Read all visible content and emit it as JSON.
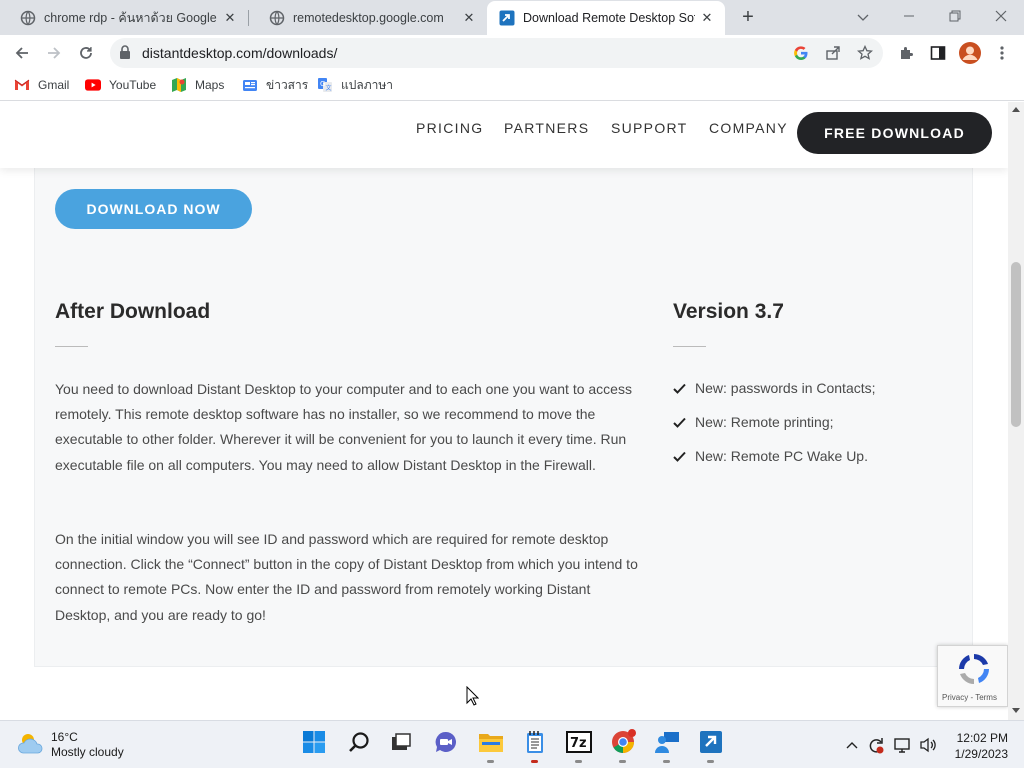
{
  "browser": {
    "tabs": [
      {
        "title": "chrome rdp - ค้นหาด้วย Google",
        "icon": "globe-icon",
        "active": false
      },
      {
        "title": "remotedesktop.google.com",
        "icon": "globe-icon",
        "active": false
      },
      {
        "title": "Download Remote Desktop Softw",
        "icon": "distant-desktop-icon",
        "active": true
      }
    ],
    "url": "distantdesktop.com/downloads/",
    "bookmarks": [
      {
        "label": "Gmail",
        "icon": "gmail-icon"
      },
      {
        "label": "YouTube",
        "icon": "youtube-icon"
      },
      {
        "label": "Maps",
        "icon": "maps-icon"
      },
      {
        "label": "ข่าวสาร",
        "icon": "news-icon"
      },
      {
        "label": "แปลภาษา",
        "icon": "translate-icon"
      }
    ],
    "new_tab_symbol": "+",
    "close_symbol": "✕"
  },
  "site": {
    "nav": [
      "PRICING",
      "PARTNERS",
      "SUPPORT",
      "COMPANY"
    ],
    "cta": "FREE DOWNLOAD",
    "download_button": "DOWNLOAD NOW",
    "after_download": {
      "heading": "After Download",
      "paragraphs": [
        "You need to download Distant Desktop to your computer and to each one you want to access remotely. This remote desktop software has no installer, so we recommend to move the executable to other folder. Wherever it will be convenient for you to launch it every time. Run executable file on all computers. You may need to allow Distant Desktop in the Firewall.",
        "On the initial window you will see ID and password which are required for remote desktop connection.  Click the “Connect” button in the copy of Distant Desktop from which you intend to connect to remote PCs.  Now enter the ID and password from remotely working Distant Desktop, and you are ready to go!"
      ]
    },
    "version": {
      "heading": "Version 3.7",
      "features": [
        "New: passwords in Contacts;",
        "New: Remote printing;",
        "New: Remote PC Wake Up."
      ]
    },
    "recaptcha": {
      "links": "Privacy - Terms"
    }
  },
  "taskbar": {
    "weather": {
      "temp": "16°C",
      "condition": "Mostly cloudy"
    },
    "apps": [
      "start-icon",
      "search-icon",
      "task-view-icon",
      "chat-icon",
      "file-explorer-icon",
      "notepad-icon",
      "7zip-icon",
      "chrome-icon",
      "remote-desktop-icon",
      "distant-desktop-icon"
    ],
    "time": "12:02 PM",
    "date": "1/29/2023"
  },
  "colors": {
    "accent_blue": "#4aa3df",
    "cta_dark": "#222326",
    "content_bg": "#f7f8f9",
    "tabstrip": "#dee1e6"
  }
}
